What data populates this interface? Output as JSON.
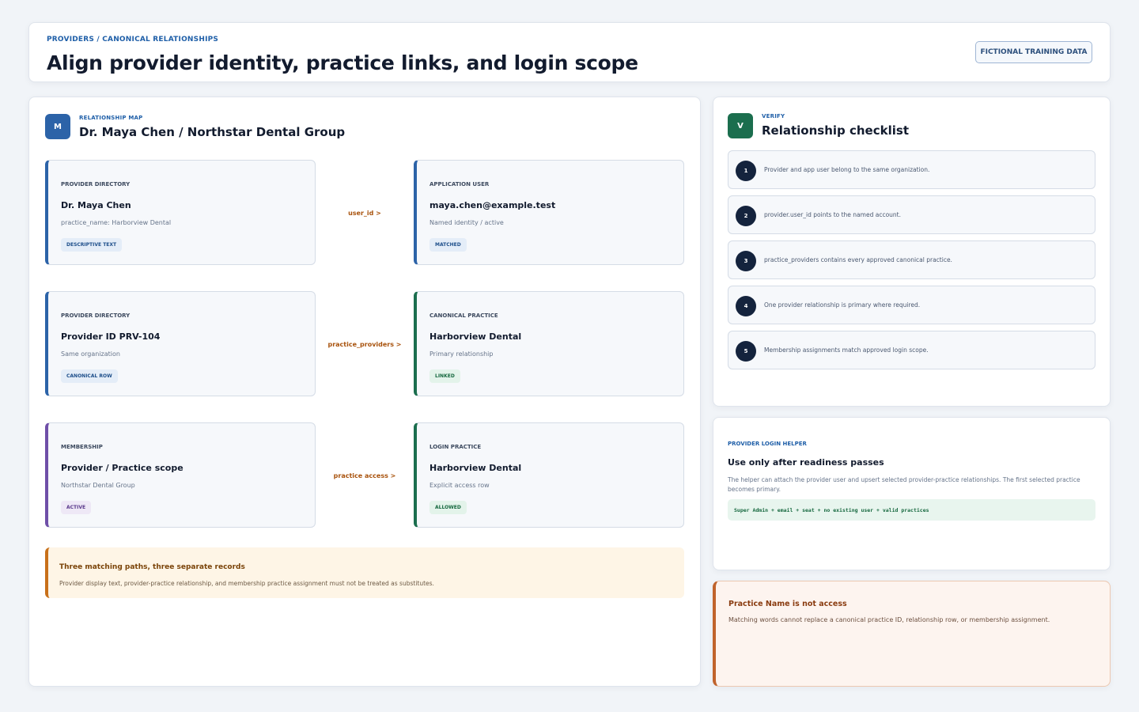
{
  "header": {
    "breadcrumb": "PROVIDERS / CANONICAL RELATIONSHIPS",
    "title": "Align provider identity, practice links, and login scope",
    "badge": "FICTIONAL TRAINING DATA"
  },
  "map": {
    "avatar": "M",
    "kicker": "RELATIONSHIP MAP",
    "title": "Dr. Maya Chen / Northstar Dental Group",
    "rows": [
      {
        "left": {
          "kicker": "PROVIDER DIRECTORY",
          "title": "Dr. Maya Chen",
          "sub": "practice_name: Harborview Dental",
          "pill": "DESCRIPTIVE TEXT"
        },
        "edge": "user_id >",
        "right": {
          "kicker": "APPLICATION USER",
          "title": "maya.chen@example.test",
          "sub": "Named identity / active",
          "pill": "MATCHED"
        }
      },
      {
        "left": {
          "kicker": "PROVIDER DIRECTORY",
          "title": "Provider ID PRV-104",
          "sub": "Same organization",
          "pill": "CANONICAL ROW"
        },
        "edge": "practice_providers >",
        "right": {
          "kicker": "CANONICAL PRACTICE",
          "title": "Harborview Dental",
          "sub": "Primary relationship",
          "pill": "LINKED"
        }
      },
      {
        "left": {
          "kicker": "MEMBERSHIP",
          "title": "Provider / Practice scope",
          "sub": "Northstar Dental Group",
          "pill": "ACTIVE"
        },
        "edge": "practice access >",
        "right": {
          "kicker": "LOGIN PRACTICE",
          "title": "Harborview Dental",
          "sub": "Explicit access row",
          "pill": "ALLOWED"
        }
      }
    ],
    "callout": {
      "title": "Three matching paths, three separate records",
      "body": "Provider display text, provider-practice relationship, and membership practice assignment must not be treated as substitutes."
    }
  },
  "checklist": {
    "avatar": "V",
    "kicker": "VERIFY",
    "title": "Relationship checklist",
    "items": [
      {
        "num": "1",
        "text": "Provider and app user belong to the same organization."
      },
      {
        "num": "2",
        "text": "provider.user_id points to the named account."
      },
      {
        "num": "3",
        "text": "practice_providers contains every approved canonical practice."
      },
      {
        "num": "4",
        "text": "One provider relationship is primary where required."
      },
      {
        "num": "5",
        "text": "Membership assignments match approved login scope."
      }
    ]
  },
  "helper": {
    "kicker": "PROVIDER LOGIN HELPER",
    "title": "Use only after readiness passes",
    "body": "The helper can attach the provider user and upsert selected provider-practice relationships. The first selected practice becomes primary.",
    "rule": "Super Admin + email + seat + no existing user + valid practices"
  },
  "warning": {
    "title": "Practice Name is not access",
    "body": "Matching words cannot replace a canonical practice ID, relationship row, or membership assignment."
  },
  "colors": {
    "accent_blue": "#2c63a8",
    "accent_green": "#1b6e4e",
    "accent_purple": "#6f4fa8",
    "edge_orange": "#a8520c",
    "navy": "#14233d"
  }
}
